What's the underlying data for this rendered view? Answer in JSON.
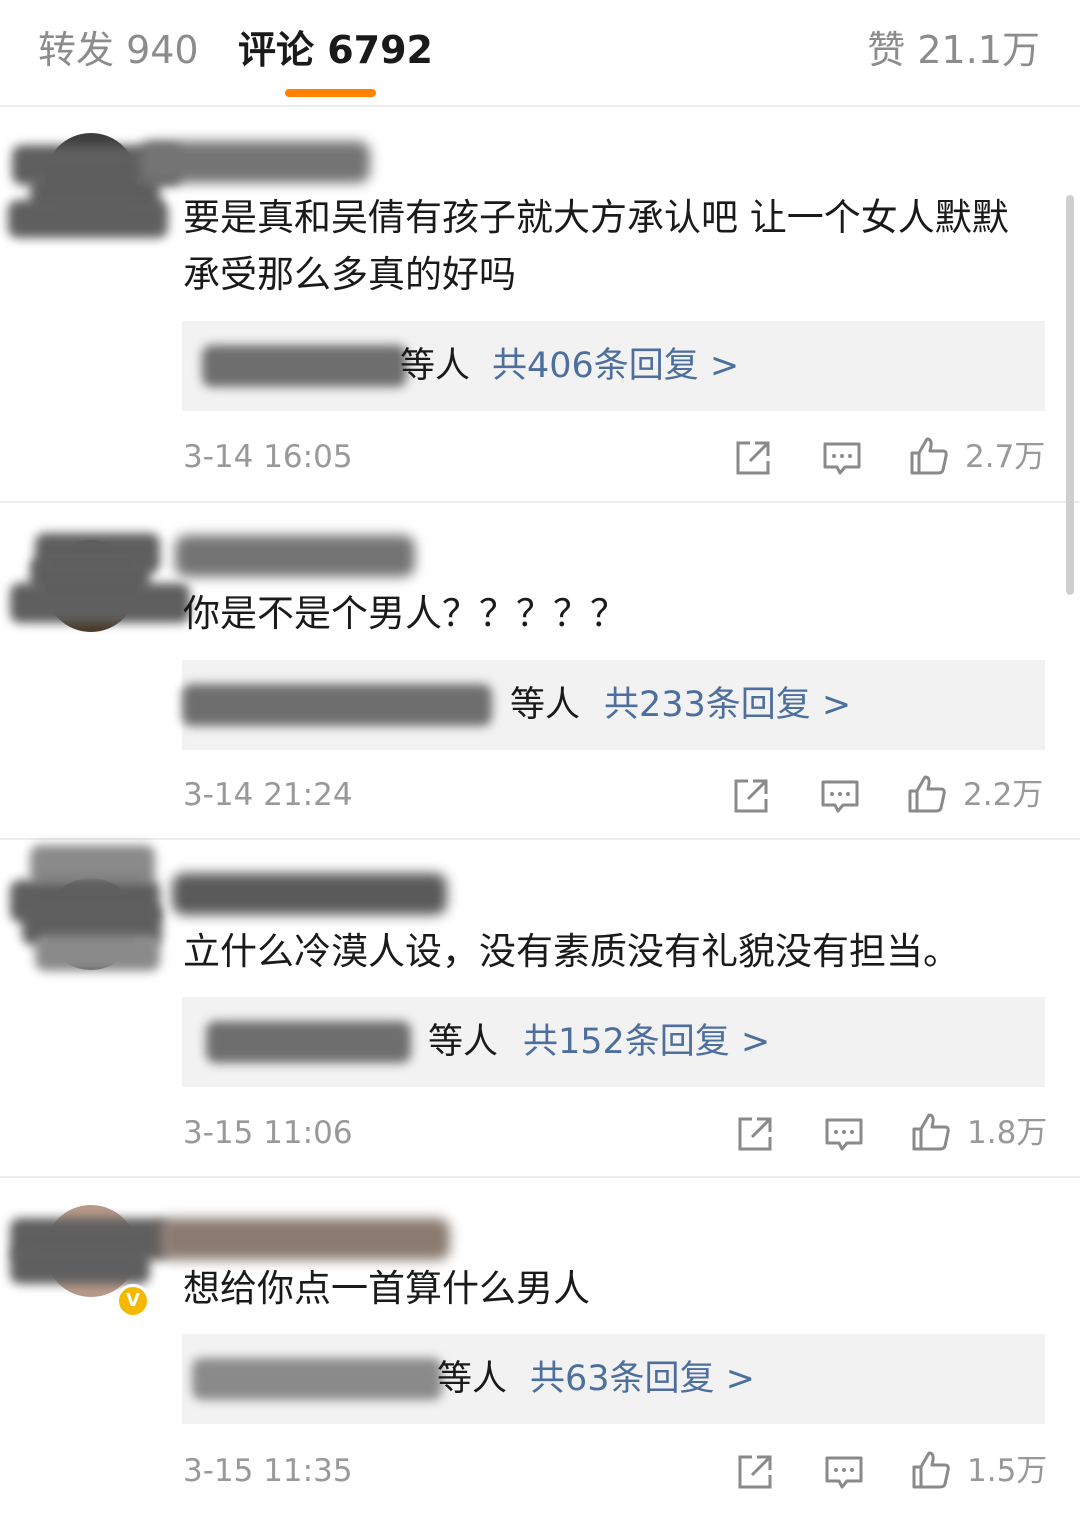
{
  "tabs": {
    "repost": "转发 940",
    "comments": "评论 6792",
    "likes": "赞 21.1万"
  },
  "colors": {
    "accent": "#ff8200",
    "link": "#4d6f9e",
    "muted": "#999999"
  },
  "comments": [
    {
      "text": "要是真和吴倩有孩子就大方承认吧 让一个女人默默承受那么多真的好吗",
      "reply_suffix": "等人",
      "reply_link": "共406条回复 >",
      "time": "3-14 16:05",
      "likes": "2.7万"
    },
    {
      "text": "你是不是个男人？？？？？",
      "reply_suffix": "等人",
      "reply_link": "共233条回复 >",
      "time": "3-14 21:24",
      "likes": "2.2万"
    },
    {
      "text": "立什么冷漠人设，没有素质没有礼貌没有担当。",
      "reply_suffix": "等人",
      "reply_link": "共152条回复 >",
      "time": "3-15 11:06",
      "likes": "1.8万"
    },
    {
      "text": "想给你点一首算什么男人",
      "reply_suffix": "等人",
      "reply_link": "共63条回复 >",
      "time": "3-15 11:35",
      "likes": "1.5万"
    }
  ],
  "icons": {
    "share": "share-icon",
    "comment": "comment-icon",
    "like": "thumbs-up-icon",
    "verified": "verified-badge-icon"
  }
}
